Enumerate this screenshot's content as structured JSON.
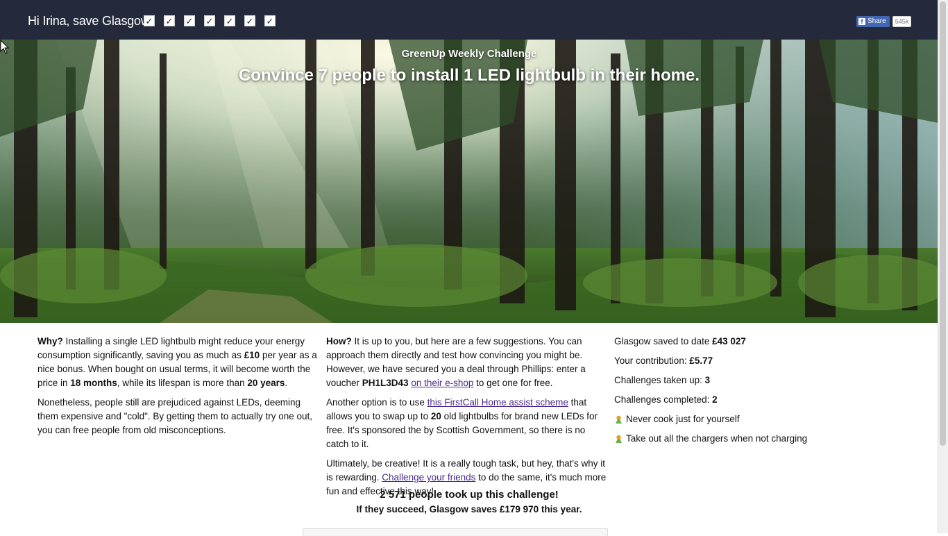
{
  "header": {
    "greeting": "Hi Irina, save Glasgow!",
    "checks": [
      "✓",
      "✓",
      "✓",
      "✓",
      "✓",
      "✓",
      "✓"
    ],
    "share_label": "Share",
    "share_count": "545k"
  },
  "hero": {
    "subtitle": "GreenUp Weekly Challenge",
    "title": "Convince 7 people to install 1 LED lightbulb in their home."
  },
  "why": {
    "lead": "Why?",
    "t1": " Installing a single LED lightbulb might reduce your energy consumption significantly, saving you as much as ",
    "b1": "£10",
    "t2": " per year as a nice bonus. When bought on usual terms, it will become worth the price in ",
    "b2": "18 months",
    "t3": ", while its lifespan is more than ",
    "b3": "20 years",
    "t4": ".",
    "p2": "Nonetheless, people still are prejudiced against LEDs, deeming them expensive and \"cold\". By getting them to actually try one out, you can free people from old misconceptions."
  },
  "how": {
    "lead": "How?",
    "t1": " It is up to you, but here are a few suggestions. You can approach them directly and test how convincing you might be. However, we have secured you a deal through Phillips: enter a voucher ",
    "voucher": "PH1L3D43",
    "link1": "on their e-shop",
    "t2": " to get one for free.",
    "p2a": "Another option is to use ",
    "link2": "this FirstCall Home assist scheme",
    "p2b": " that allows you to swap up to ",
    "p2num": "20",
    "p2c": " old lightbulbs for brand new LEDs for free. It's sponsored the by Scottish Government, so there is no catch to it.",
    "p3a": "Ultimately, be creative! It is a really tough task, but hey, that's why it is rewarding. ",
    "link3": "Challenge your friends",
    "p3b": " to do the same, it's much more fun and effective this way!"
  },
  "stats": {
    "saved_label": "Glasgow saved to date ",
    "saved_value": "£43 027",
    "contrib_label": "Your contribution: ",
    "contrib_value": "£5.77",
    "taken_label": "Challenges taken up: ",
    "taken_value": "3",
    "completed_label": "Challenges completed: ",
    "completed_value": "2",
    "tips": [
      "Never cook just for yourself",
      "Take out all the chargers when not charging"
    ]
  },
  "footer": {
    "line1": "2 571 people took up this challenge!",
    "line2": "If they succeed, Glasgow saves £179 970 this year."
  }
}
